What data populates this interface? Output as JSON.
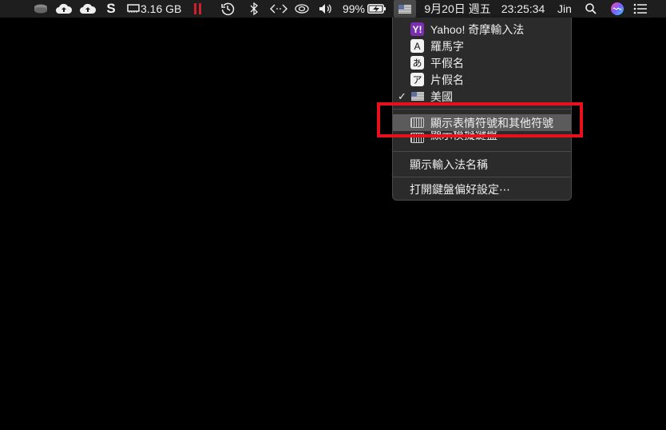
{
  "menubar": {
    "memory": "3.16 GB",
    "battery_percent": "99%",
    "date": "9月20日 週五",
    "time": "23:25:34",
    "user": "Jin",
    "battery_level": 0.99
  },
  "input_menu": {
    "items": [
      {
        "icon": "Y!",
        "label": "Yahoo! 奇摩輸入法"
      },
      {
        "icon": "A",
        "label": "羅馬字"
      },
      {
        "icon": "あ",
        "label": "平假名"
      },
      {
        "icon": "ア",
        "label": "片假名"
      },
      {
        "icon": "flag",
        "label": "美國",
        "checked": true,
        "check_mark": "✓"
      }
    ],
    "highlighted_item": "顯示表情符號和其他符號",
    "partially_hidden_item": "顯示模擬鍵盤",
    "show_input_name": "顯示輸入法名稱",
    "open_keyboard_prefs": "打開鍵盤偏好設定⋯"
  },
  "annotation": {
    "color": "#e8101c"
  }
}
